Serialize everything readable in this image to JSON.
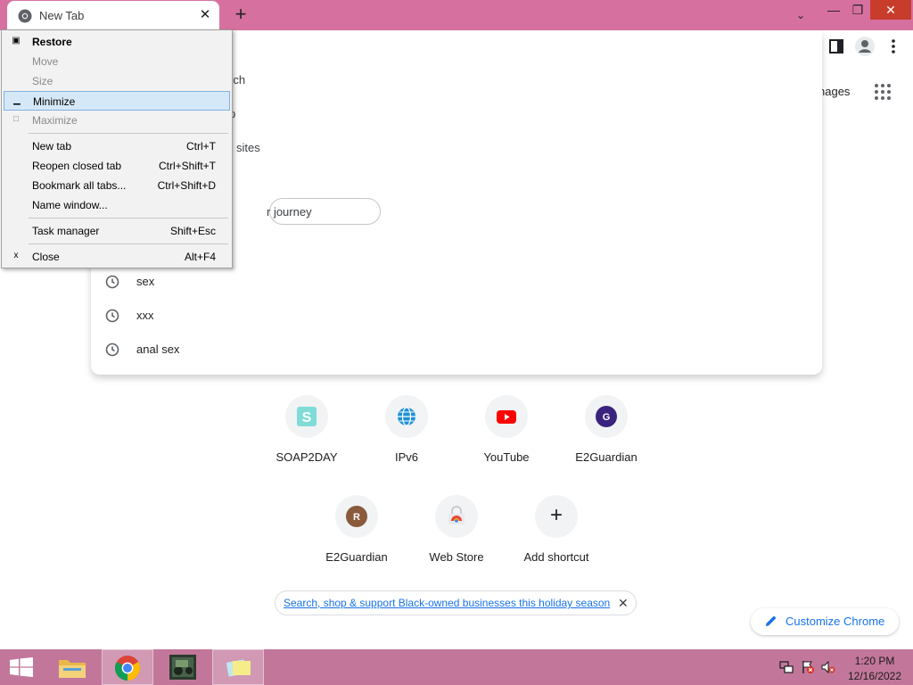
{
  "browser": {
    "tab_title": "New Tab",
    "tab_close_glyph": "✕",
    "new_tab_glyph": "+",
    "tab_search_glyph": "⌄",
    "window_min_glyph": "—",
    "window_restore_glyph": "❐",
    "window_close_glyph": "✕"
  },
  "omnibox": {
    "fragments": [
      "rch",
      "p",
      "sites",
      "r journey"
    ],
    "history": [
      {
        "text": "sex",
        "icon": "clock-icon"
      },
      {
        "text": "xxx",
        "icon": "clock-icon"
      },
      {
        "text": "anal sex",
        "icon": "clock-icon"
      }
    ]
  },
  "ntp": {
    "images_link": "nages",
    "shortcuts": [
      {
        "label": "SOAP2DAY",
        "icon": "soap2day-icon",
        "letter": "S"
      },
      {
        "label": "IPv6",
        "icon": "globe-icon"
      },
      {
        "label": "YouTube",
        "icon": "youtube-icon"
      },
      {
        "label": "E2Guardian",
        "icon": "letter-avatar-icon",
        "letter": "G"
      },
      {
        "label": "E2Guardian",
        "icon": "letter-avatar-icon",
        "letter": "R"
      },
      {
        "label": "Web Store",
        "icon": "webstore-icon"
      },
      {
        "label": "Add shortcut",
        "icon": "plus-icon",
        "letter": "+"
      }
    ],
    "promo_text": "Search, shop & support Black-owned businesses this holiday season",
    "promo_close": "✕",
    "customize_label": "Customize Chrome"
  },
  "system_menu": {
    "items": [
      {
        "label": "Restore",
        "shortcut": "",
        "icon": "▣",
        "disabled": false,
        "bold": true
      },
      {
        "label": "Move",
        "shortcut": "",
        "icon": "",
        "disabled": true
      },
      {
        "label": "Size",
        "shortcut": "",
        "icon": "",
        "disabled": true
      },
      {
        "label": "Minimize",
        "shortcut": "",
        "icon": "▁",
        "disabled": false,
        "hover": true
      },
      {
        "label": "Maximize",
        "shortcut": "",
        "icon": "□",
        "disabled": true
      },
      {
        "label": "New tab",
        "shortcut": "Ctrl+T",
        "icon": ""
      },
      {
        "label": "Reopen closed tab",
        "shortcut": "Ctrl+Shift+T",
        "icon": ""
      },
      {
        "label": "Bookmark all tabs...",
        "shortcut": "Ctrl+Shift+D",
        "icon": ""
      },
      {
        "label": "Name window...",
        "shortcut": "",
        "icon": ""
      },
      {
        "label": "Task manager",
        "shortcut": "Shift+Esc",
        "icon": ""
      },
      {
        "label": "Close",
        "shortcut": "Alt+F4",
        "icon": "x"
      }
    ]
  },
  "taskbar": {
    "time": "1:20 PM",
    "date": "12/16/2022"
  },
  "colors": {
    "titlebar": "#d6719f",
    "taskbar": "#c2779a",
    "accent": "#1a73e8"
  }
}
